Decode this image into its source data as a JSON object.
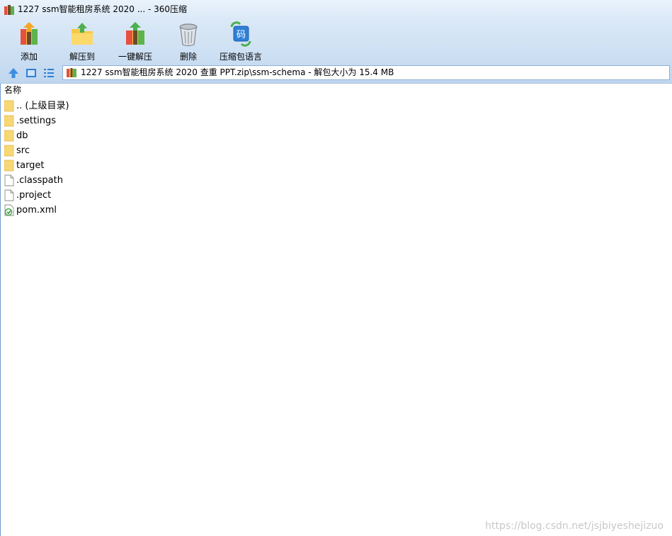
{
  "window": {
    "title": "1227 ssm智能租房系统  2020 ... - 360压缩"
  },
  "toolbar": {
    "buttons": [
      {
        "label": "添加",
        "icon": "add-archive-icon"
      },
      {
        "label": "解压到",
        "icon": "extract-to-icon"
      },
      {
        "label": "一键解压",
        "icon": "one-click-extract-icon"
      },
      {
        "label": "删除",
        "icon": "trash-can-icon"
      },
      {
        "label": "压缩包语言",
        "icon": "archive-language-icon",
        "icon_glyph": "码"
      }
    ]
  },
  "nav": {
    "icons": [
      "up-arrow-icon",
      "view-thumbnail-icon",
      "view-list-icon"
    ]
  },
  "address": {
    "path": "1227 ssm智能租房系统  2020 查重 PPT.zip\\ssm-schema - 解包大小为 15.4 MB"
  },
  "list": {
    "column_header": "名称",
    "items": [
      {
        "name": ".. (上级目录)",
        "type": "folder"
      },
      {
        "name": ".settings",
        "type": "folder"
      },
      {
        "name": "db",
        "type": "folder"
      },
      {
        "name": "src",
        "type": "folder"
      },
      {
        "name": "target",
        "type": "folder"
      },
      {
        "name": ".classpath",
        "type": "file"
      },
      {
        "name": ".project",
        "type": "file"
      },
      {
        "name": "pom.xml",
        "type": "xml"
      }
    ]
  },
  "watermark": "https://blog.csdn.net/jsjbiyeshejizuo",
  "colors": {
    "accent": "#2f7fd6",
    "folder": "#f8d775",
    "toolbar_bg": "#d3e4f5"
  }
}
